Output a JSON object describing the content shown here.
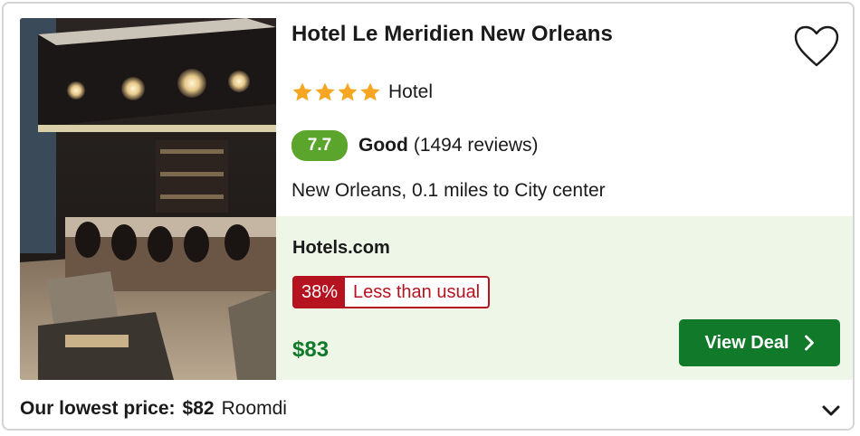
{
  "hotel": {
    "name": "Hotel Le Meridien New Orleans",
    "star_rating": 4,
    "type": "Hotel",
    "score": "7.7",
    "score_word": "Good",
    "reviews": "(1494 reviews)",
    "location": "New Orleans, 0.1 miles to City center"
  },
  "deal": {
    "provider": "Hotels.com",
    "discount_pct": "38%",
    "discount_text": "Less than usual",
    "price": "$83",
    "cta_label": "View Deal"
  },
  "footer": {
    "lowest_label": "Our lowest price:",
    "lowest_price": "$82",
    "lowest_provider": "Roomdi"
  },
  "icons": {
    "favorite": "heart-outline-icon",
    "star": "star-filled-icon",
    "cta_arrow": "chevron-right-icon",
    "expand": "chevron-down-icon"
  },
  "colors": {
    "score_badge": "#5ba52d",
    "star": "#f5a623",
    "deal_panel": "#eef6e8",
    "discount": "#b5131f",
    "price": "#117a2a",
    "cta": "#117a2a"
  }
}
